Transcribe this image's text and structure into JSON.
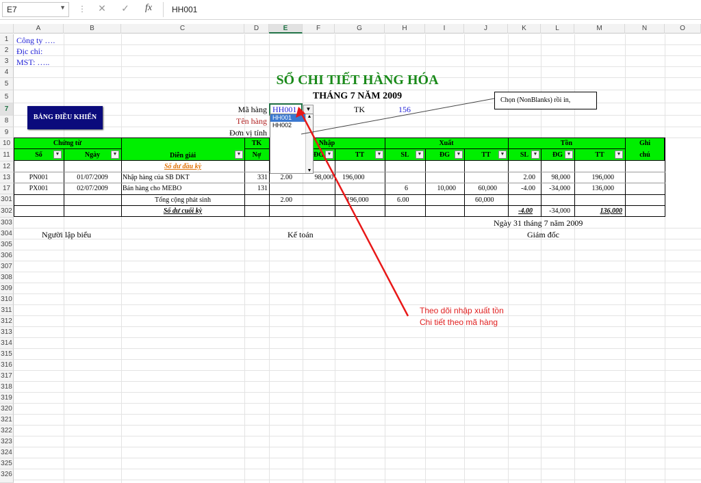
{
  "formula_bar": {
    "name_box": "E7",
    "cancel_icon": "✕",
    "enter_icon": "✓",
    "fx_label": "fx",
    "formula": "HH001"
  },
  "columns": [
    "A",
    "B",
    "C",
    "D",
    "E",
    "F",
    "G",
    "H",
    "I",
    "J",
    "K",
    "L",
    "M",
    "N",
    "O"
  ],
  "rows": [
    "1",
    "2",
    "3",
    "4",
    "5",
    "7",
    "8",
    "9",
    "10",
    "11",
    "12",
    "13",
    "17",
    "301",
    "302",
    "303",
    "304",
    "305",
    "306",
    "307",
    "308",
    "309",
    "310",
    "311",
    "312",
    "313",
    "314",
    "315",
    "316",
    "317",
    "318",
    "319",
    "320",
    "321",
    "322",
    "323",
    "324",
    "325",
    "326"
  ],
  "sheet": {
    "company": "Công ty ….",
    "address": "Địc chỉ:",
    "tax_code": "MST: …..",
    "title": "SỔ CHI TIẾT HÀNG HÓA",
    "subtitle": "THÁNG 7 NĂM 2009",
    "control_button": "BẢNG ĐIỀU KHIỂN",
    "ma_hang_label": "Mã hàng",
    "ma_hang_value": "HH001",
    "tk_label": "TK",
    "tk_value": "156",
    "ten_hang_label": "Tên hàng",
    "don_vi_label": "Đơn vị tính",
    "dropdown_options": [
      "HH001",
      "HH002"
    ],
    "callout": "Chọn (NonBlanks) rồi in,",
    "annotation_line1": "Theo dõi nhập xuất tồn",
    "annotation_line2": "Chi tiết theo mã hàng"
  },
  "table": {
    "group_headers": {
      "chung_tu": "Chứng từ",
      "tk": "TK",
      "nhap": "Nhập",
      "xuat": "Xuất",
      "ton": "Tồn",
      "ghi": "Ghi"
    },
    "sub_headers": {
      "so": "Số",
      "ngay": "Ngày",
      "dien_giai": "Diễn giải",
      "tk_sub": "Nợ",
      "dg_nhap": "ĐG",
      "tt_nhap": "TT",
      "sl_xuat": "SL",
      "dg_xuat": "ĐG",
      "tt_xuat": "TT",
      "sl_ton": "SL",
      "dg_ton": "ĐG",
      "tt_ton": "TT",
      "chu": "chú"
    },
    "opening_label": "Số dư đầu kỳ",
    "rows": [
      {
        "so": "PN001",
        "ngay": "01/07/2009",
        "dien_giai": "Nhập hàng của SB DKT",
        "tk": "331",
        "sl_nhap": "2.00",
        "dg_nhap": "98,000",
        "tt_nhap": "196,000",
        "sl_xuat": "",
        "dg_xuat": "",
        "tt_xuat": "",
        "sl_ton": "2.00",
        "dg_ton": "98,000",
        "tt_ton": "196,000"
      },
      {
        "so": "PX001",
        "ngay": "02/07/2009",
        "dien_giai": "Bán hàng cho MEBO",
        "tk": "131",
        "sl_nhap": "",
        "dg_nhap": "",
        "tt_nhap": "",
        "sl_xuat": "6",
        "dg_xuat": "10,000",
        "tt_xuat": "60,000",
        "sl_ton": "-4.00",
        "dg_ton": "-34,000",
        "tt_ton": "136,000"
      }
    ],
    "total_label": "Tổng cộng phát sinh",
    "total": {
      "sl_nhap": "2.00",
      "tt_nhap": "196,000",
      "sl_xuat": "6.00",
      "tt_xuat": "60,000"
    },
    "closing_label": "Số dư cuối kỳ",
    "closing": {
      "sl_ton": "-4.00",
      "dg_ton": "-34,000",
      "tt_ton": "136,000"
    }
  },
  "footer": {
    "date": "Ngày 31 tháng 7 năm 2009",
    "preparer": "Người lập biểu",
    "accountant": "Kế toán",
    "director": "Giám đốc"
  }
}
